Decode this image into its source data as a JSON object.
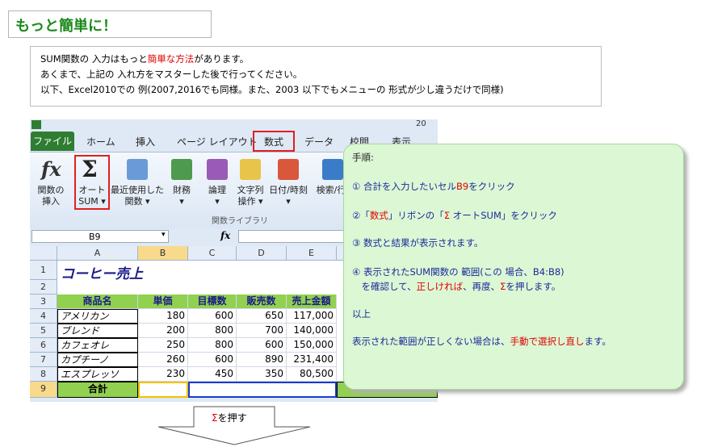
{
  "title": "もっと簡単に！",
  "intro": {
    "line1_pre": "SUM関数の 入力はもっと",
    "line1_red": "簡単な方法",
    "line1_post": "があります。",
    "line2": "あくまで、上記の 入れ方をマスターした後で行ってください。",
    "line3": "以下、Excel2010での 例(2007,2016でも同様。また、2003 以下でもメニューの 形式が少し違うだけで同様)"
  },
  "excel": {
    "qat_number": "20",
    "tabs": [
      "ファイル",
      "ホーム",
      "挿入",
      "ページ レイアウト",
      "数式",
      "データ",
      "校閲",
      "表示"
    ],
    "ribbon": {
      "fx_label1": "関数の",
      "fx_label2": "挿入",
      "autosum_label1": "オート",
      "autosum_label2": "SUM",
      "recent_label1": "最近使用した",
      "recent_label2": "関数",
      "finance_label": "財務",
      "logic_label": "論理",
      "text_label1": "文字列",
      "text_label2": "操作",
      "date_label": "日付/時刻",
      "lookup_label": "検索/行",
      "group_label": "関数ライブラリ"
    },
    "name_box": "B9",
    "fx_symbol": "fx",
    "col_headers": [
      "A",
      "B",
      "C",
      "D",
      "E"
    ],
    "row_headers": [
      "1",
      "2",
      "3",
      "4",
      "5",
      "6",
      "7",
      "8",
      "9"
    ],
    "sheet_title": "コーヒー売上",
    "headers": [
      "商品名",
      "単価",
      "目標数",
      "販売数",
      "売上金額"
    ],
    "rows": [
      [
        "アメリカン",
        "180",
        "600",
        "650",
        "117,000"
      ],
      [
        "ブレンド",
        "200",
        "800",
        "700",
        "140,000"
      ],
      [
        "カフェオレ",
        "250",
        "800",
        "600",
        "150,000"
      ],
      [
        "カプチーノ",
        "260",
        "600",
        "890",
        "231,400"
      ],
      [
        "エスプレッソ",
        "230",
        "450",
        "350",
        "80,500"
      ]
    ],
    "total_label": "合計"
  },
  "callout": {
    "heading": "手順:",
    "step1_pre": "① 合計を入力したいセル",
    "step1_red": "B9",
    "step1_post": "をクリック",
    "step2_pre": "②「",
    "step2_red": "数式",
    "step2_mid": "」リボンの「",
    "step2_red2": "Σ",
    "step2_post": " オートSUM」をクリック",
    "step3": "③ 数式と結果が表示されます。",
    "step4_line1": "④ 表示されたSUM関数の 範囲(この 場合、B4:B8)",
    "step4_line2_pre": "　を確認して、",
    "step4_line2_red1": "正しければ",
    "step4_line2_mid": "、再度、",
    "step4_line2_red2": "Σ",
    "step4_line2_post": "を押します。",
    "done": "以上",
    "note_pre": "表示された範囲が正しくない場合は、",
    "note_red": "手動で選択し直し",
    "note_post": "ます。"
  },
  "arrow": {
    "sigma": "Σ",
    "text": "を押す"
  },
  "colors": {
    "title_green": "#1a8a1a",
    "accent_red": "#e00000",
    "callout_bg": "#dcf7d4",
    "file_tab": "#2e7d32",
    "header_fill": "#92d050"
  }
}
